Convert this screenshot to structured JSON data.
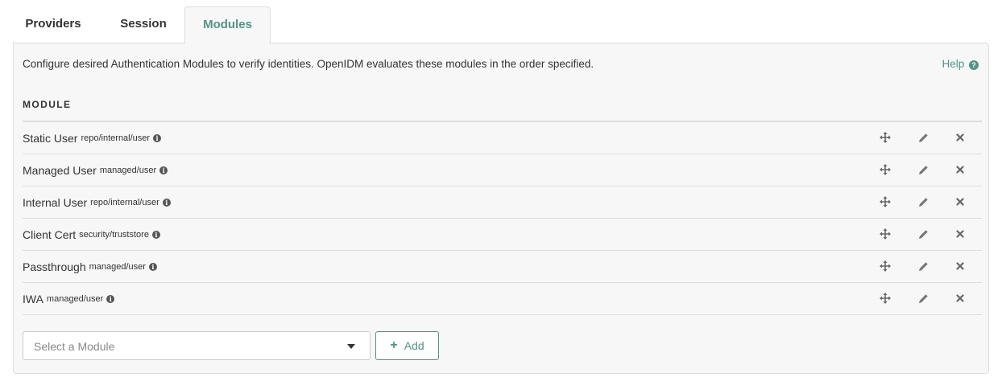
{
  "tabs": {
    "providers": "Providers",
    "session": "Session",
    "modules": "Modules"
  },
  "panel": {
    "description": "Configure desired Authentication Modules to verify identities. OpenIDM evaluates these modules in the order specified.",
    "help_label": "Help",
    "column_header": "MODULE"
  },
  "modules": [
    {
      "name": "Static User",
      "path": "repo/internal/user"
    },
    {
      "name": "Managed User",
      "path": "managed/user"
    },
    {
      "name": "Internal User",
      "path": "repo/internal/user"
    },
    {
      "name": "Client Cert",
      "path": "security/truststore"
    },
    {
      "name": "Passthrough",
      "path": "managed/user"
    },
    {
      "name": "IWA",
      "path": "managed/user"
    }
  ],
  "add_module": {
    "select_placeholder": "Select a Module",
    "add_label": "Add"
  },
  "icons": {
    "help": "question-circle-icon",
    "info": "info-circle-icon",
    "move": "move-arrows-icon",
    "edit": "pencil-icon",
    "delete": "close-icon",
    "caret": "caret-down-icon",
    "plus": "plus-icon"
  },
  "colors": {
    "accent": "#519387",
    "panel_background": "#f7f7f7",
    "border": "#dddddd",
    "text": "#333333"
  }
}
